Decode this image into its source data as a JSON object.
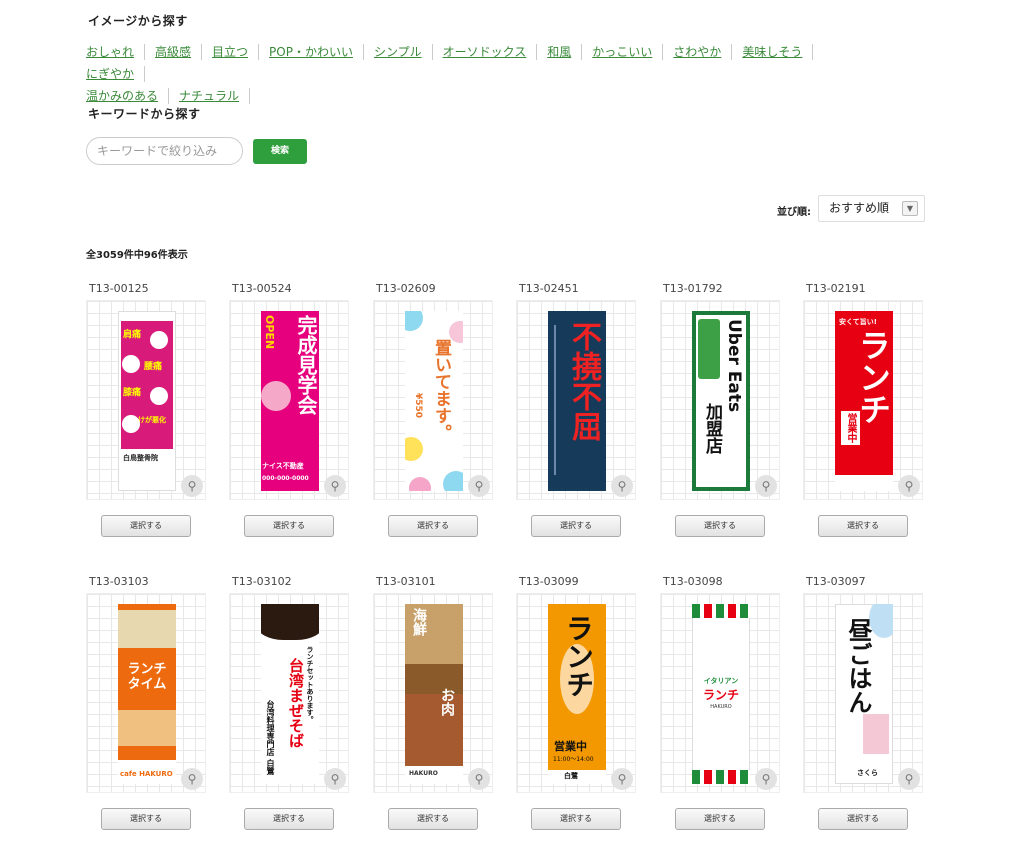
{
  "image_search": {
    "title": "イメージから探す",
    "tags": [
      "おしゃれ",
      "高級感",
      "目立つ",
      "POP・かわいい",
      "シンプル",
      "オーソドックス",
      "和風",
      "かっこいい",
      "さわやか",
      "美味しそう",
      "にぎやか",
      "温かみのある",
      "ナチュラル"
    ]
  },
  "keyword_search": {
    "title": "キーワードから探す",
    "placeholder": "キーワードで絞り込み",
    "button": "検索"
  },
  "sort": {
    "label": "並び順:",
    "value": "おすすめ順"
  },
  "result_count": "全3059件中96件表示",
  "select_label": "選択する",
  "colors": {
    "accent": "#2f9e3c",
    "link": "#3a8a3a"
  },
  "products": [
    {
      "id": "T13-00125",
      "banner": {
        "lines": [
          "肩痛",
          "腰痛",
          "膝痛",
          "けが悪化"
        ],
        "footer": "白鳥整骨院"
      }
    },
    {
      "id": "T13-00524",
      "banner": {
        "lines": [
          "完成見学会",
          "OPEN"
        ],
        "footer": "ナイス不動産",
        "phone": "000-000-0000"
      }
    },
    {
      "id": "T13-02609",
      "banner": {
        "lines": [
          "置いてます。",
          "¥550"
        ]
      }
    },
    {
      "id": "T13-02451",
      "banner": {
        "lines": [
          "不撓不屈"
        ]
      }
    },
    {
      "id": "T13-01792",
      "banner": {
        "lines": [
          "Uber Eats",
          "加盟店"
        ]
      }
    },
    {
      "id": "T13-02191",
      "banner": {
        "lines": [
          "ランチ",
          "営業中",
          "安くて旨い!"
        ]
      }
    },
    {
      "id": "T13-03103",
      "banner": {
        "lines": [
          "ランチタイム"
        ],
        "footer": "cafe HAKURO"
      }
    },
    {
      "id": "T13-03102",
      "banner": {
        "lines": [
          "台湾まぜそば",
          "ランチセットあります。"
        ],
        "footer": "台湾料理専門店 白鷺"
      }
    },
    {
      "id": "T13-03101",
      "banner": {
        "lines": [
          "海鮮",
          "お肉"
        ],
        "footer": "HAKURO"
      }
    },
    {
      "id": "T13-03099",
      "banner": {
        "lines": [
          "ランチ",
          "営業中",
          "11:00〜14:00"
        ],
        "footer": "白鷺"
      }
    },
    {
      "id": "T13-03098",
      "banner": {
        "lines": [
          "イタリアン",
          "ランチ"
        ],
        "footer": "HAKURO"
      }
    },
    {
      "id": "T13-03097",
      "banner": {
        "lines": [
          "昼ごはん"
        ],
        "footer": "さくら"
      }
    }
  ]
}
